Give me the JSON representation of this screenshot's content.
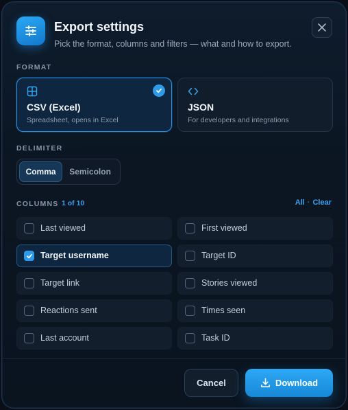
{
  "header": {
    "title": "Export settings",
    "subtitle": "Pick the format, columns and filters — what and how to export.",
    "icon": "sliders-icon",
    "close_icon": "close-icon"
  },
  "format": {
    "label": "FORMAT",
    "options": [
      {
        "name": "CSV (Excel)",
        "description": "Spreadsheet, opens in Excel",
        "icon": "table-icon",
        "selected": true
      },
      {
        "name": "JSON",
        "description": "For developers and integrations",
        "icon": "code-icon",
        "selected": false
      }
    ]
  },
  "delimiter": {
    "label": "DELIMITER",
    "options": [
      "Comma",
      "Semicolon"
    ],
    "selected": "Comma"
  },
  "columns": {
    "label": "COLUMNS",
    "count": "1 of 10",
    "all_label": "All",
    "separator": "·",
    "clear_label": "Clear",
    "items": [
      {
        "label": "Last viewed",
        "checked": false
      },
      {
        "label": "First viewed",
        "checked": false
      },
      {
        "label": "Target username",
        "checked": true
      },
      {
        "label": "Target ID",
        "checked": false
      },
      {
        "label": "Target link",
        "checked": false
      },
      {
        "label": "Stories viewed",
        "checked": false
      },
      {
        "label": "Reactions sent",
        "checked": false
      },
      {
        "label": "Times seen",
        "checked": false
      },
      {
        "label": "Last account",
        "checked": false
      },
      {
        "label": "Task ID",
        "checked": false
      }
    ]
  },
  "footer": {
    "cancel_label": "Cancel",
    "download_label": "Download",
    "download_icon": "download-icon"
  },
  "colors": {
    "accent": "#2e9be8",
    "background": "#0b1622"
  }
}
